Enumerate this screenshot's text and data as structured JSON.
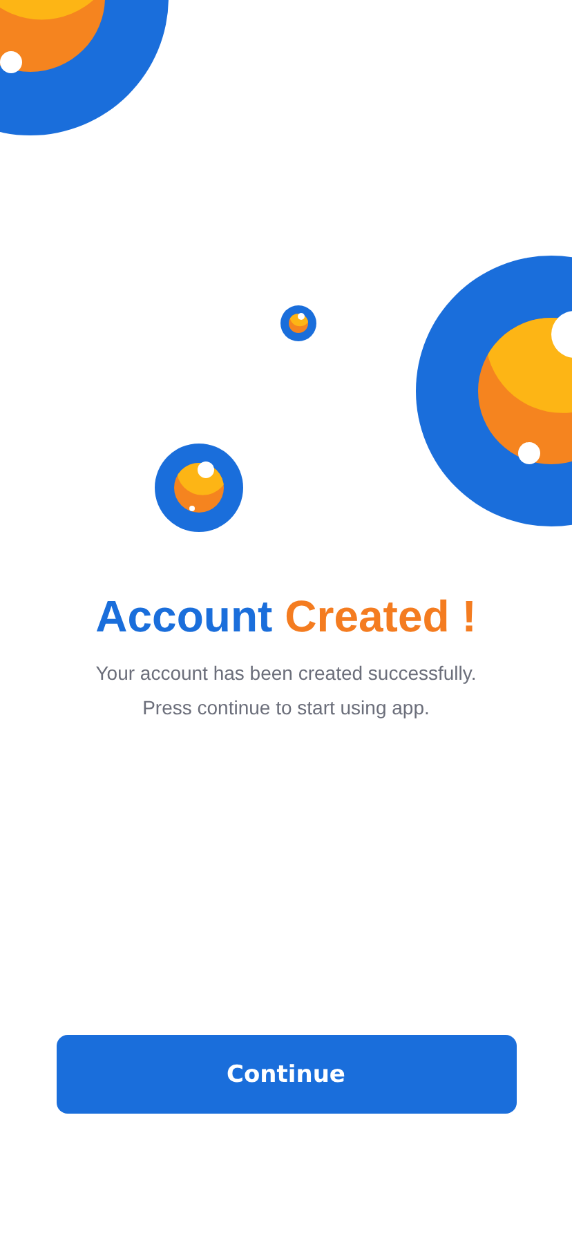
{
  "title": [
    {
      "text": "Account",
      "color": "#1a6edb"
    },
    {
      "text": "Created !",
      "color": "#f47c20"
    }
  ],
  "message": [
    "Your account has been created successfully.",
    "Press continue to start using app."
  ],
  "button": {
    "label": "Continue"
  }
}
